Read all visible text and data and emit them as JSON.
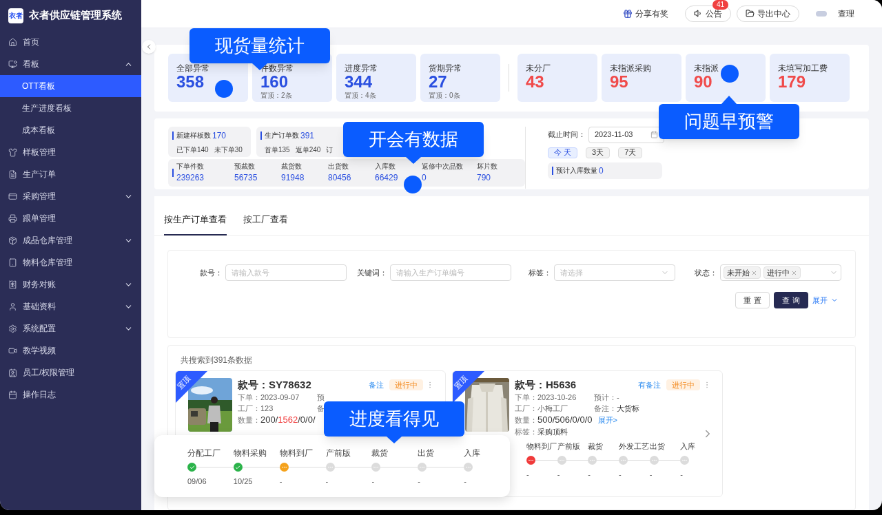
{
  "brand": {
    "logo": "衣者",
    "name": "衣者供应链管理系统"
  },
  "sidebar": {
    "items": [
      {
        "label": "首页",
        "expandable": false,
        "selected": false
      },
      {
        "label": "看板",
        "expandable": true,
        "expanded": true,
        "selected": false,
        "children": [
          {
            "label": "OTT看板",
            "selected": true
          },
          {
            "label": "生产进度看板",
            "selected": false
          },
          {
            "label": "成本看板",
            "selected": false
          }
        ]
      },
      {
        "label": "样板管理",
        "expandable": false,
        "selected": false
      },
      {
        "label": "生产订单",
        "expandable": false,
        "selected": false
      },
      {
        "label": "采购管理",
        "expandable": true,
        "expanded": false,
        "selected": false
      },
      {
        "label": "跟单管理",
        "expandable": false,
        "selected": false
      },
      {
        "label": "成品仓库管理",
        "expandable": true,
        "expanded": false,
        "selected": false
      },
      {
        "label": "物料仓库管理",
        "expandable": false,
        "selected": false
      },
      {
        "label": "财务对账",
        "expandable": true,
        "expanded": false,
        "selected": false
      },
      {
        "label": "基础资料",
        "expandable": true,
        "expanded": false,
        "selected": false
      },
      {
        "label": "系统配置",
        "expandable": true,
        "expanded": false,
        "selected": false
      },
      {
        "label": "教学视频",
        "expandable": false,
        "selected": false
      },
      {
        "label": "员工/权限管理",
        "expandable": false,
        "selected": false
      },
      {
        "label": "操作日志",
        "expandable": false,
        "selected": false
      }
    ]
  },
  "header": {
    "share": "分享有奖",
    "notice": {
      "label": "公告",
      "badge": "41"
    },
    "export": "导出中心",
    "user": "查理"
  },
  "stats": {
    "groups": [
      [
        {
          "kind": "count",
          "label": "全部异常",
          "value": "358"
        },
        {
          "kind": "count",
          "label": "件数异常",
          "value": "160",
          "sub": "置顶：2条"
        },
        {
          "kind": "count",
          "label": "进度异常",
          "value": "344",
          "sub": "置顶：4条"
        },
        {
          "kind": "count",
          "label": "货期异常",
          "value": "27",
          "sub": "置顶：0条"
        }
      ],
      [
        {
          "kind": "alert",
          "label": "未分厂",
          "value": "43"
        },
        {
          "kind": "alert",
          "label": "未指派采购",
          "value": "95"
        },
        {
          "kind": "alert",
          "label": "未指派",
          "value": "90"
        },
        {
          "kind": "alert",
          "label": "未填写加工费",
          "value": "179"
        }
      ]
    ]
  },
  "summary": {
    "boxes": [
      {
        "label": "新建样板数",
        "value": "170",
        "subs": [
          "已下单140",
          "未下单30"
        ]
      },
      {
        "label": "生产订单数",
        "value": "391",
        "subs": [
          "首单135",
          "返单240",
          "订"
        ]
      }
    ],
    "metrics": [
      {
        "label": "下单件数",
        "value": "239263"
      },
      {
        "label": "预裁数",
        "value": "56735"
      },
      {
        "label": "裁货数",
        "value": "91948"
      },
      {
        "label": "出货数",
        "value": "80456"
      },
      {
        "label": "入库数",
        "value": "66429"
      },
      {
        "label": "返修中次品数",
        "value": "0"
      },
      {
        "label": "坏片数",
        "value": "790"
      }
    ],
    "deadline": {
      "label": "截止时间：",
      "value": "2023-11-03"
    },
    "ranges": [
      {
        "label": "今 天",
        "selected": true
      },
      {
        "label": "3天",
        "selected": false
      },
      {
        "label": "7天",
        "selected": false
      }
    ],
    "forecast": {
      "label": "预计入库数量",
      "value": "0"
    }
  },
  "tabs": [
    {
      "label": "按生产订单查看",
      "selected": true
    },
    {
      "label": "按工厂查看",
      "selected": false
    }
  ],
  "filters": [
    {
      "kind": "input",
      "label": "款号：",
      "placeholder": "请输入款号"
    },
    {
      "kind": "input",
      "label": "关键词：",
      "placeholder": "请输入生产订单编号"
    },
    {
      "kind": "select",
      "label": "标签：",
      "placeholder": "请选择"
    },
    {
      "kind": "tags",
      "label": "状态：",
      "tags": [
        "未开始",
        "进行中"
      ]
    }
  ],
  "buttons": {
    "reset": "重 置",
    "query": "查 询",
    "expand": "展开"
  },
  "results": {
    "summary": "共搜索到391条数据",
    "cards": [
      {
        "pinned": true,
        "pin_label": "置顶",
        "code_label": "款号：",
        "code": "SY78632",
        "note_link": "备注",
        "status": "进行中",
        "rows": [
          [
            {
              "label": "下单：",
              "value": "2023-09-07"
            },
            {
              "label": "预"
            }
          ],
          [
            {
              "label": "工厂：",
              "value": "123"
            },
            {
              "label": "备"
            }
          ]
        ],
        "quantity": {
          "label": "数量：",
          "parts": [
            {
              "text": "200/",
              "alert": false
            },
            {
              "text": "1562",
              "alert": true
            },
            {
              "text": "/0/0/",
              "alert": false
            }
          ]
        }
      },
      {
        "pinned": true,
        "pin_label": "置顶",
        "code_label": "款号：",
        "code": "H5636",
        "note_link": "有备注",
        "status": "进行中",
        "rows": [
          [
            {
              "label": "下单：",
              "value": "2023-10-26"
            },
            {
              "label": "预计：",
              "value": "-"
            }
          ],
          [
            {
              "label": "工厂：",
              "value": "小梅工厂"
            },
            {
              "label": "备注：",
              "value": "大货标"
            }
          ]
        ],
        "quantity": {
          "label": "数量：",
          "parts": [
            {
              "text": "500/506/0/0/0",
              "alert": false
            }
          ]
        },
        "expand_link": "展开>",
        "tag_line": {
          "label": "标签：",
          "value": "采购顶料"
        },
        "steps": [
          {
            "label": "物料到厂",
            "kind": "alert",
            "date": "-"
          },
          {
            "label": "产前版",
            "kind": "todo",
            "date": "-"
          },
          {
            "label": "裁货",
            "kind": "todo",
            "date": "-"
          },
          {
            "label": "外发工艺",
            "kind": "todo",
            "date": "-"
          },
          {
            "label": "出货",
            "kind": "todo",
            "date": "-"
          },
          {
            "label": "入库",
            "kind": "todo",
            "date": "-"
          }
        ]
      }
    ]
  },
  "progress_card": {
    "steps": [
      {
        "label": "分配工厂",
        "kind": "done",
        "date": "09/06"
      },
      {
        "label": "物料采购",
        "kind": "done",
        "date": "10/25"
      },
      {
        "label": "物料到厂",
        "kind": "pending",
        "date": "-"
      },
      {
        "label": "产前版",
        "kind": "todo",
        "date": "-"
      },
      {
        "label": "裁货",
        "kind": "todo",
        "date": "-"
      },
      {
        "label": "出货",
        "kind": "todo",
        "date": "-"
      },
      {
        "label": "入库",
        "kind": "todo",
        "date": "-"
      }
    ]
  },
  "callouts": [
    {
      "text": "现货量统计",
      "kind": "down",
      "dot": true
    },
    {
      "text": "开会有数据",
      "kind": "down",
      "dot": true
    },
    {
      "text": "问题早预警",
      "kind": "up",
      "dot": true
    },
    {
      "text": "进度看得见",
      "kind": "down"
    }
  ]
}
